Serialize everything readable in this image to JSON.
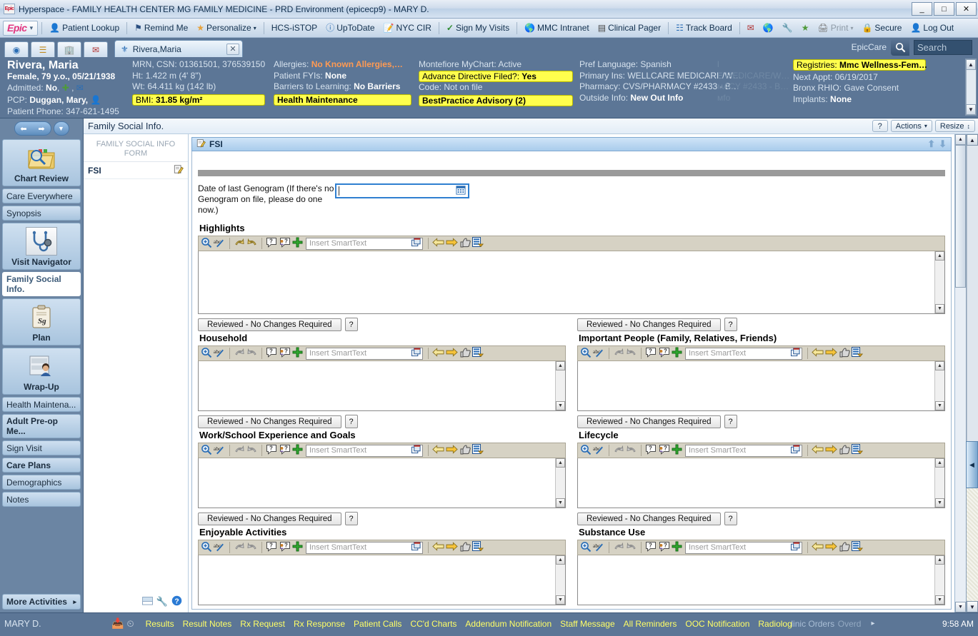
{
  "window": {
    "title": "Hyperspace - FAMILY HEALTH CENTER MG FAMILY MEDICINE - PRD Environment (epicecp9) - MARY D.",
    "app_icon": "epic-icon",
    "minimize": "_",
    "maximize": "□",
    "close": "✕"
  },
  "menubar": {
    "epic_label": "Epic",
    "items": [
      {
        "label": "Patient Lookup",
        "icon": "person-icon"
      },
      {
        "label": "Remind Me",
        "icon": "flag-icon"
      },
      {
        "label": "Personalize",
        "icon": "star-icon",
        "caret": "▾"
      },
      {
        "label": "HCS-iSTOP",
        "icon": "none"
      },
      {
        "label": "UpToDate",
        "icon": "info-circle-icon"
      },
      {
        "label": "NYC CIR",
        "icon": "form-pen-icon"
      },
      {
        "label": "Sign My Visits",
        "icon": "check-icon"
      },
      {
        "label": "MMC Intranet",
        "icon": "globe-icon"
      },
      {
        "label": "Clinical Pager",
        "icon": "pager-icon"
      },
      {
        "label": "Track Board",
        "icon": "board-icon"
      }
    ],
    "right_items": [
      {
        "label": "",
        "icon": "inbasket-icon"
      },
      {
        "label": "",
        "icon": "globe-icon"
      },
      {
        "label": "",
        "icon": "wrench-icon"
      },
      {
        "label": "",
        "icon": "star-green-icon"
      },
      {
        "label": "Print",
        "icon": "printer-icon",
        "caret": "▾",
        "disabled": true
      },
      {
        "label": "Secure",
        "icon": "lock-icon"
      },
      {
        "label": "Log Out",
        "icon": "logout-person-icon"
      }
    ]
  },
  "tabstrip": {
    "square_tabs": [
      {
        "name": "schedule-tab",
        "icon": "pie-chart-icon"
      },
      {
        "name": "inbasket-tab",
        "icon": "list-key-icon"
      },
      {
        "name": "chart-tab",
        "icon": "building-icon"
      },
      {
        "name": "mail-tab",
        "icon": "envelope-icon"
      }
    ],
    "patient_tab": {
      "label": "Rivera,Maria",
      "icon": "stethoscope-icon",
      "close": "✕"
    },
    "epiccare_label": "EpicCare",
    "search_placeholder": "Search",
    "search_icon": "search-icon"
  },
  "patient_header": {
    "name": "Rivera, Maria",
    "demographics": "Female, 79 y.o., 05/21/1938",
    "admitted_label": "Admitted:",
    "admitted_value": "No",
    "pcp_label": "PCP:",
    "pcp_value": "Duggan, Mary,",
    "phone_label": "Patient Phone:",
    "phone_value": "347-621-1495",
    "col2": [
      {
        "label": "MRN, CSN:",
        "value": "01361501, 376539150"
      },
      {
        "label": "Ht:",
        "value": "1.422 m (4' 8\")"
      },
      {
        "label": "Wt:",
        "value": "64.411 kg (142 lb)"
      }
    ],
    "bmi_label": "BMI:",
    "bmi_value": "31.85 kg/m²",
    "col3": [
      {
        "label": "Allergies:",
        "value": "No Known Allergies,…",
        "style": "orange"
      },
      {
        "label": "Patient FYIs:",
        "value": "None"
      },
      {
        "label": "Barriers to Learning:",
        "value": "No Barriers"
      }
    ],
    "health_maintenance": "Health Maintenance",
    "col4": [
      {
        "label": "Montefiore MyChart:",
        "value": "Active"
      }
    ],
    "advance_directive_label": "Advance Directive Filed?:",
    "advance_directive_value": "Yes",
    "code_label": "Code:",
    "code_value": "Not on file",
    "bpa": "BestPractice Advisory (2)",
    "col5": [
      {
        "label": "Pref Language:",
        "value": "Spanish"
      },
      {
        "label": "Primary Ins:",
        "value": "WELLCARE MEDICARE/W…"
      },
      {
        "label": "Pharmacy:",
        "value": "CVS/PHARMACY #2433 - B…"
      },
      {
        "label": "Outside Info:",
        "value": "New Out Info"
      }
    ],
    "ghost_col": [
      "l",
      "E MEDICARE/W…",
      "мACY #2433 - B…",
      "мfo"
    ],
    "registries_label": "Registries:",
    "registries_value": "Mmc Wellness-Fem…",
    "col6": [
      {
        "label": "Next Appt:",
        "value": "06/19/2017"
      },
      {
        "label": "Bronx RHIO:",
        "value": "Gave Consent"
      },
      {
        "label": "Implants:",
        "value": "None"
      }
    ]
  },
  "activity_bar": {
    "back_icon": "back-arrow-icon",
    "forward_icon": "forward-arrow-icon",
    "dropdown_icon": "chevron-down-icon",
    "items": [
      {
        "label": "Chart Review",
        "icon": "folder-search-icon",
        "big": true,
        "bold": true
      },
      {
        "label": "Care Everywhere",
        "icon": "none",
        "big": false,
        "bold": false
      },
      {
        "label": "Synopsis",
        "icon": "none",
        "big": false,
        "bold": false
      },
      {
        "label": "Visit Navigator",
        "icon": "stethoscope-icon",
        "big": true,
        "bold": true
      },
      {
        "label": "Family Social Info.",
        "icon": "none",
        "big": false,
        "bold": true,
        "selected": true
      },
      {
        "label": "Plan",
        "icon": "clipboard-sign-icon",
        "big": true,
        "bold": true
      },
      {
        "label": "Wrap-Up",
        "icon": "person-window-icon",
        "big": true,
        "bold": true
      },
      {
        "label": "Health Maintena...",
        "icon": "none",
        "big": false,
        "bold": false
      },
      {
        "label": "Adult Pre-op Me...",
        "icon": "none",
        "big": false,
        "bold": true
      },
      {
        "label": "Sign Visit",
        "icon": "none",
        "big": false,
        "bold": false
      },
      {
        "label": "Care Plans",
        "icon": "none",
        "big": false,
        "bold": true
      },
      {
        "label": "Demographics",
        "icon": "none",
        "big": false,
        "bold": false
      },
      {
        "label": "Notes",
        "icon": "none",
        "big": false,
        "bold": false
      }
    ],
    "more_label": "More Activities",
    "more_caret": "▸"
  },
  "workspace": {
    "title": "Family Social Info.",
    "help_label": "?",
    "actions_label": "Actions",
    "actions_caret": "▾",
    "resize_label": "Resize",
    "resize_caret": "↕"
  },
  "index_panel": {
    "heading_line1": "FAMILY SOCIAL INFO",
    "heading_line2": "FORM",
    "item_label": "FSI",
    "item_icon": "pencil-form-icon",
    "footer_icons": [
      "restore-icon",
      "wrench-icon",
      "help-circle-icon"
    ]
  },
  "form": {
    "header_title": "FSI",
    "header_icon": "pencil-form-icon",
    "up_icon": "arrow-up-icon",
    "down_icon": "arrow-down-icon",
    "genogram_label": "Date of last Genogram (If there's no Genogram on file, please do one now.)",
    "genogram_value": "",
    "genogram_calendar_icon": "calendar-icon",
    "smarttext_placeholder": "Insert SmartText",
    "reviewed_label": "Reviewed - No Changes Required",
    "question_label": "?",
    "toolbar_icons": [
      "zoom-in-icon",
      "spellcheck-icon",
      "undo-icon",
      "redo-icon",
      "smartphrase-icon",
      "smartlink-icon",
      "add-plus-icon",
      "prev-arrow-icon",
      "next-arrow-icon",
      "thumb-icon",
      "template-icon"
    ],
    "sections": [
      {
        "title": "Highlights",
        "value": "",
        "column": "full",
        "enabled_undo": true
      },
      {
        "title": "Household",
        "value": "",
        "column": "left",
        "enabled_undo": false
      },
      {
        "title": "Important People (Family, Relatives, Friends)",
        "value": "",
        "column": "right",
        "enabled_undo": false
      },
      {
        "title": "Work/School Experience and Goals",
        "value": "",
        "column": "left",
        "enabled_undo": true
      },
      {
        "title": "Lifecycle",
        "value": "",
        "column": "right",
        "enabled_undo": true
      },
      {
        "title": "Enjoyable Activities",
        "value": "",
        "column": "left",
        "enabled_undo": true
      },
      {
        "title": "Substance Use",
        "value": "",
        "column": "right",
        "enabled_undo": true
      }
    ]
  },
  "bottom_bar": {
    "user": "MARY D.",
    "icons": [
      "inbasket-red-icon",
      "clock-icon"
    ],
    "links": [
      "Results",
      "Result Notes",
      "Rx Request",
      "Rx Response",
      "Patient Calls",
      "CC'd Charts",
      "Addendum Notification",
      "Staff Message",
      "All Reminders",
      "OOC Notification",
      "Radiolog"
    ],
    "ghost_links": [
      "linic Orders",
      "Overd"
    ],
    "more_caret": "▸",
    "time": "9:58 AM"
  }
}
